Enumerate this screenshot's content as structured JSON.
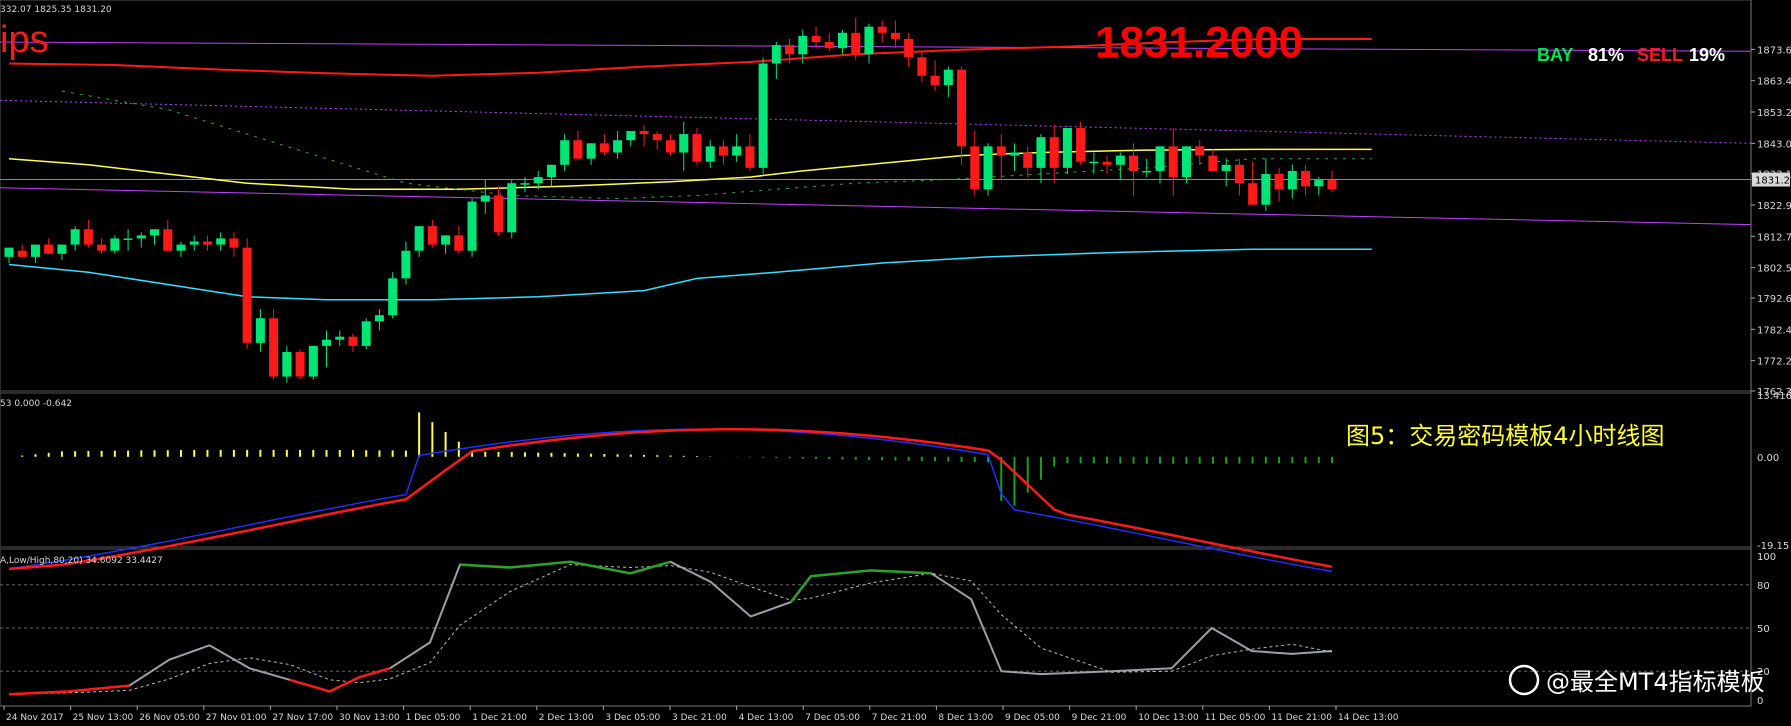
{
  "header": {
    "ohlc_readout": "332.07 1825.35 1831.20",
    "ticker_fragment": "ips",
    "big_price": "1831.2000",
    "bay_label": "BAY",
    "bay_value": "81%",
    "sell_label": "SELL",
    "sell_value": "19%"
  },
  "caption": "图5：交易密码模板4小时线图",
  "watermark": "@最全MT4指标模板",
  "macd_header": "53 0.000 -0.642",
  "stoch_header": "A,Low/High,80,20) 34.6092 33.4427",
  "colors": {
    "up": "#00e676",
    "down": "#ff1a1a",
    "ma_red": "#ff1a1a",
    "ma_yellow": "#ffff4d",
    "ma_cyan": "#33e0ff",
    "channel": "#c040ff",
    "macd_blue": "#2030ff",
    "macd_red": "#ff1a1a",
    "hist_up": "#ffff55",
    "hist_down": "#1e9e1e",
    "stoch_green": "#2ea02e",
    "stoch_red": "#ff1a1a",
    "stoch_gray": "#9aa0a8"
  },
  "chart_data": [
    {
      "type": "candlestick",
      "name": "price",
      "ylim": [
        1762.3,
        1883.5
      ],
      "yticks": [
        "1873.60",
        "1863.40",
        "1853.20",
        "1843.00",
        "1833.10",
        "1822.90",
        "1812.70",
        "1802.50",
        "1792.60",
        "1782.40",
        "1772.20",
        "1762.30"
      ],
      "current_price_label": "1831.20",
      "xticks": [
        "24 Nov 2017",
        "25 Nov 13:00",
        "26 Nov 05:00",
        "27 Nov 01:00",
        "27 Nov 17:00",
        "30 Nov 13:00",
        "1 Dec 05:00",
        "1 Dec 21:00",
        "2 Dec 13:00",
        "3 Dec 05:00",
        "3 Dec 21:00",
        "4 Dec 13:00",
        "7 Dec 05:00",
        "7 Dec 21:00",
        "8 Dec 13:00",
        "9 Dec 05:00",
        "9 Dec 21:00",
        "10 Dec 13:00",
        "11 Dec 05:00",
        "11 Dec 21:00",
        "14 Dec 13:00"
      ],
      "candles": [
        [
          1806,
          1809,
          1804,
          1809
        ],
        [
          1808,
          1810,
          1806,
          1806
        ],
        [
          1806,
          1810,
          1804,
          1810
        ],
        [
          1810,
          1812,
          1807,
          1807
        ],
        [
          1807,
          1809,
          1805,
          1810
        ],
        [
          1810,
          1816,
          1808,
          1815
        ],
        [
          1815,
          1818,
          1809,
          1810
        ],
        [
          1810,
          1812,
          1807,
          1808
        ],
        [
          1808,
          1813,
          1807,
          1812
        ],
        [
          1812,
          1815,
          1808,
          1812
        ],
        [
          1812,
          1814,
          1809,
          1813
        ],
        [
          1813,
          1815,
          1810,
          1815
        ],
        [
          1815,
          1818,
          1810,
          1808
        ],
        [
          1808,
          1811,
          1806,
          1810
        ],
        [
          1810,
          1813,
          1808,
          1811
        ],
        [
          1811,
          1813,
          1808,
          1810
        ],
        [
          1810,
          1814,
          1808,
          1812
        ],
        [
          1812,
          1814,
          1806,
          1809
        ],
        [
          1809,
          1812,
          1776,
          1778
        ],
        [
          1778,
          1789,
          1775,
          1786
        ],
        [
          1786,
          1789,
          1766,
          1767
        ],
        [
          1767,
          1777,
          1765,
          1775
        ],
        [
          1775,
          1776,
          1766,
          1767
        ],
        [
          1767,
          1777,
          1766,
          1777
        ],
        [
          1777,
          1782,
          1770,
          1779
        ],
        [
          1779,
          1782,
          1777,
          1780
        ],
        [
          1780,
          1781,
          1775,
          1777
        ],
        [
          1777,
          1786,
          1776,
          1785
        ],
        [
          1785,
          1789,
          1782,
          1787
        ],
        [
          1787,
          1801,
          1786,
          1799
        ],
        [
          1799,
          1811,
          1797,
          1808
        ],
        [
          1808,
          1816,
          1806,
          1816
        ],
        [
          1816,
          1818,
          1809,
          1810
        ],
        [
          1810,
          1813,
          1807,
          1813
        ],
        [
          1813,
          1816,
          1807,
          1808
        ],
        [
          1808,
          1825,
          1806,
          1824
        ],
        [
          1824,
          1831,
          1820,
          1826
        ],
        [
          1826,
          1829,
          1813,
          1814
        ],
        [
          1814,
          1831,
          1812,
          1830
        ],
        [
          1830,
          1832,
          1827,
          1830
        ],
        [
          1830,
          1834,
          1828,
          1832
        ],
        [
          1832,
          1836,
          1829,
          1836
        ],
        [
          1836,
          1846,
          1834,
          1844
        ],
        [
          1844,
          1847,
          1838,
          1838
        ],
        [
          1838,
          1843,
          1836,
          1843
        ],
        [
          1843,
          1846,
          1839,
          1840
        ],
        [
          1840,
          1847,
          1838,
          1844
        ],
        [
          1844,
          1847,
          1842,
          1847
        ],
        [
          1847,
          1849,
          1842,
          1846
        ],
        [
          1846,
          1847,
          1841,
          1844
        ],
        [
          1844,
          1846,
          1839,
          1840
        ],
        [
          1840,
          1850,
          1834,
          1846
        ],
        [
          1846,
          1848,
          1836,
          1837
        ],
        [
          1837,
          1844,
          1835,
          1842
        ],
        [
          1842,
          1844,
          1836,
          1839
        ],
        [
          1839,
          1846,
          1837,
          1842
        ],
        [
          1842,
          1846,
          1834,
          1835
        ],
        [
          1835,
          1871,
          1833,
          1869
        ],
        [
          1869,
          1876,
          1864,
          1875
        ],
        [
          1875,
          1877,
          1869,
          1872
        ],
        [
          1872,
          1880,
          1869,
          1878
        ],
        [
          1878,
          1881,
          1874,
          1876
        ],
        [
          1876,
          1879,
          1873,
          1874
        ],
        [
          1874,
          1880,
          1872,
          1879
        ],
        [
          1879,
          1884,
          1870,
          1872
        ],
        [
          1872,
          1882,
          1869,
          1881
        ],
        [
          1881,
          1883,
          1876,
          1879
        ],
        [
          1879,
          1883,
          1874,
          1877
        ],
        [
          1877,
          1879,
          1868,
          1871
        ],
        [
          1871,
          1873,
          1863,
          1865
        ],
        [
          1865,
          1870,
          1860,
          1862
        ],
        [
          1862,
          1868,
          1858,
          1867
        ],
        [
          1867,
          1868,
          1836,
          1842
        ],
        [
          1842,
          1847,
          1826,
          1828
        ],
        [
          1828,
          1843,
          1826,
          1842
        ],
        [
          1842,
          1846,
          1831,
          1839
        ],
        [
          1839,
          1843,
          1834,
          1840
        ],
        [
          1840,
          1842,
          1832,
          1835
        ],
        [
          1835,
          1846,
          1830,
          1845
        ],
        [
          1845,
          1849,
          1830,
          1835
        ],
        [
          1835,
          1848,
          1833,
          1848
        ],
        [
          1848,
          1850,
          1836,
          1837
        ],
        [
          1837,
          1840,
          1833,
          1837
        ],
        [
          1837,
          1839,
          1833,
          1836
        ],
        [
          1836,
          1840,
          1831,
          1839
        ],
        [
          1839,
          1843,
          1826,
          1834
        ],
        [
          1834,
          1838,
          1832,
          1834
        ],
        [
          1834,
          1842,
          1830,
          1842
        ],
        [
          1842,
          1848,
          1826,
          1832
        ],
        [
          1832,
          1842,
          1830,
          1842
        ],
        [
          1842,
          1844,
          1836,
          1839
        ],
        [
          1839,
          1841,
          1834,
          1834
        ],
        [
          1834,
          1838,
          1829,
          1836
        ],
        [
          1836,
          1838,
          1826,
          1830
        ],
        [
          1830,
          1837,
          1825,
          1823
        ],
        [
          1823,
          1838,
          1821,
          1833
        ],
        [
          1833,
          1835,
          1824,
          1828
        ],
        [
          1828,
          1836,
          1825,
          1834
        ],
        [
          1834,
          1836,
          1826,
          1829
        ],
        [
          1829,
          1832,
          1826,
          1831
        ],
        [
          1831,
          1834,
          1827,
          1828
        ]
      ]
    },
    {
      "type": "bar+line",
      "name": "macd",
      "ylim": [
        -19.15,
        13.416
      ],
      "yticks": [
        "13.416",
        "0.00",
        "-19.15"
      ]
    },
    {
      "type": "line",
      "name": "stochastic",
      "ylim": [
        0,
        100
      ],
      "yticks": [
        "100",
        "80",
        "50",
        "20",
        "0"
      ]
    }
  ]
}
